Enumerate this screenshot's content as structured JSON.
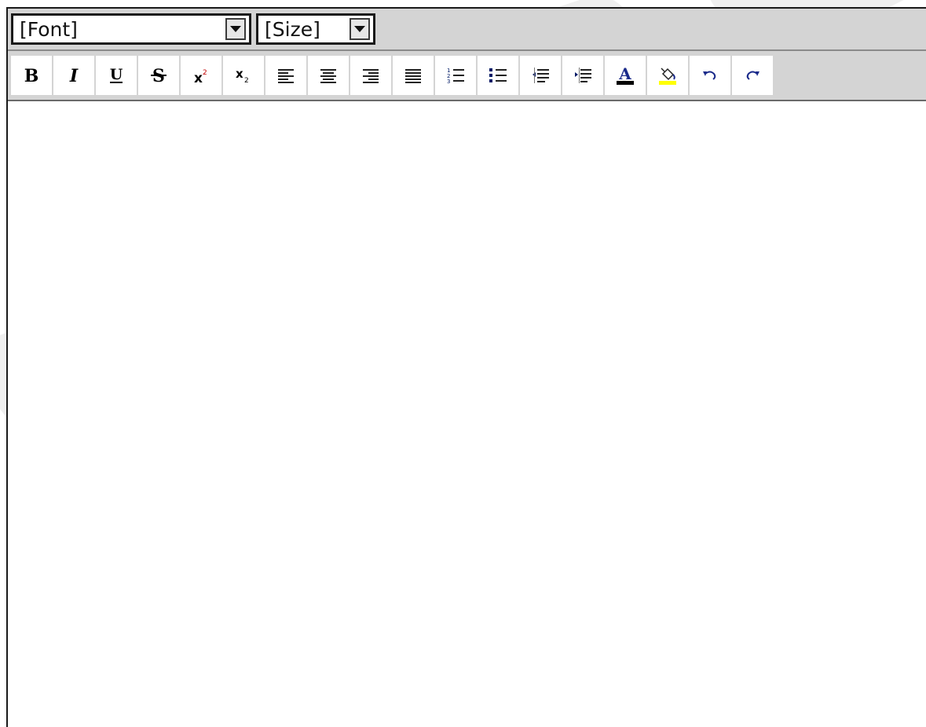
{
  "font_select": {
    "value": "[Font]",
    "arrow_icon": "dropdown-arrow-icon"
  },
  "size_select": {
    "value": "[Size]",
    "arrow_icon": "dropdown-arrow-icon"
  },
  "toolbar": [
    {
      "name": "bold-button",
      "icon": "bold-icon"
    },
    {
      "name": "italic-button",
      "icon": "italic-icon"
    },
    {
      "name": "underline-button",
      "icon": "underline-icon"
    },
    {
      "name": "strikethrough-button",
      "icon": "strikethrough-icon"
    },
    {
      "name": "superscript-button",
      "icon": "superscript-icon"
    },
    {
      "name": "subscript-button",
      "icon": "subscript-icon"
    },
    {
      "name": "align-left-button",
      "icon": "align-left-icon"
    },
    {
      "name": "align-center-button",
      "icon": "align-center-icon"
    },
    {
      "name": "align-right-button",
      "icon": "align-right-icon"
    },
    {
      "name": "justify-button",
      "icon": "justify-icon"
    },
    {
      "name": "ordered-list-button",
      "icon": "ordered-list-icon"
    },
    {
      "name": "unordered-list-button",
      "icon": "unordered-list-icon"
    },
    {
      "name": "outdent-button",
      "icon": "outdent-icon"
    },
    {
      "name": "indent-button",
      "icon": "indent-icon"
    },
    {
      "name": "font-color-button",
      "icon": "font-color-icon"
    },
    {
      "name": "highlight-color-button",
      "icon": "paint-bucket-icon"
    },
    {
      "name": "undo-button",
      "icon": "undo-icon"
    },
    {
      "name": "redo-button",
      "icon": "redo-icon"
    }
  ],
  "colors": {
    "toolbar_bg": "#d4d4d4",
    "font_color_bar": "#000000",
    "highlight_bar": "#ffff00",
    "watermark": "#f0f0f0"
  }
}
